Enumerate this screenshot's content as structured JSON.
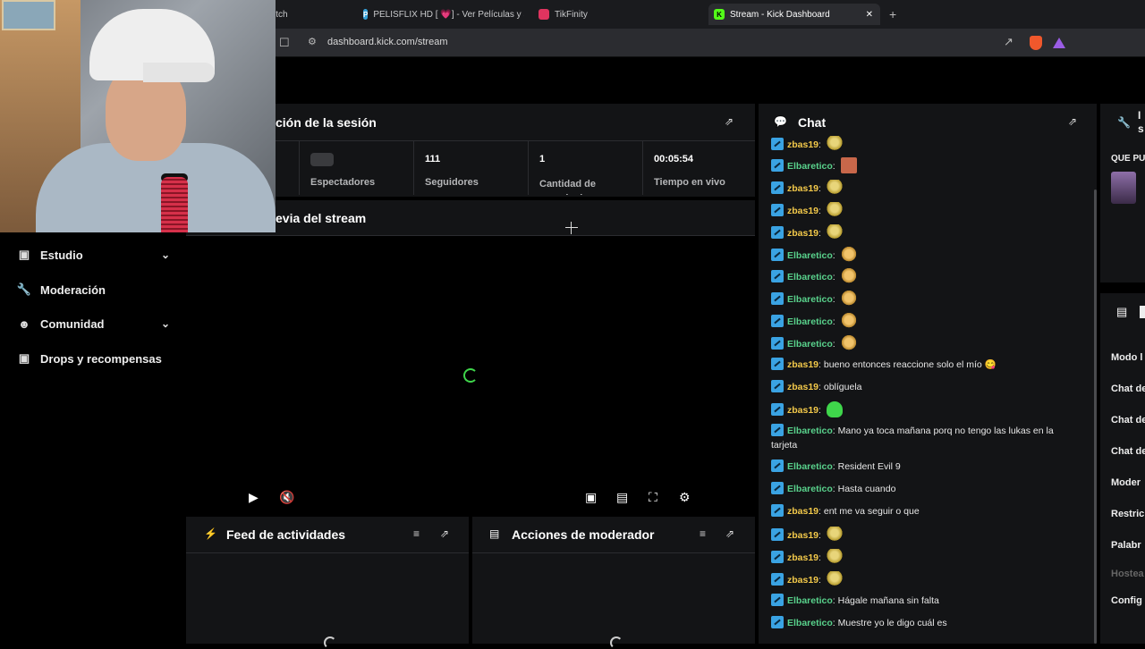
{
  "browser": {
    "tabs": [
      {
        "label": "itch",
        "active": false
      },
      {
        "label": "PELISFLIX HD [ 💗] - Ver Películas y S",
        "active": false
      },
      {
        "label": "TikFinity",
        "active": false
      },
      {
        "label": "Stream - Kick Dashboard",
        "active": true
      }
    ],
    "close_glyph": "✕",
    "new_tab_glyph": "+",
    "url": "dashboard.kick.com/stream"
  },
  "sidebar": {
    "items": [
      {
        "label": "Estudio",
        "icon": "studio-icon",
        "has_chevron": true
      },
      {
        "label": "Moderación",
        "icon": "wrench-icon",
        "has_chevron": false
      },
      {
        "label": "Comunidad",
        "icon": "community-icon",
        "has_chevron": true
      },
      {
        "label": "Drops y recompensas",
        "icon": "gift-icon",
        "has_chevron": false
      }
    ]
  },
  "session": {
    "title": "ción de la sesión",
    "stats": [
      {
        "value": "",
        "label": "Espectadores"
      },
      {
        "value": "111",
        "label": "Seguidores"
      },
      {
        "value": "1",
        "label": "Cantidad de suscripciones"
      },
      {
        "value": "00:05:54",
        "label": "Tiempo en vivo"
      }
    ]
  },
  "preview": {
    "title": "evia del stream"
  },
  "activity_feed": {
    "title": "Feed de actividades"
  },
  "mod_actions": {
    "title": "Acciones de moderador"
  },
  "chat": {
    "title": "Chat",
    "messages": [
      {
        "user": "zbas19",
        "text": "",
        "emote": "em-corn"
      },
      {
        "user": "Elbaretico",
        "text": "",
        "emote": "em-face"
      },
      {
        "user": "zbas19",
        "text": "",
        "emote": "em-corn"
      },
      {
        "user": "zbas19",
        "text": "",
        "emote": "em-corn"
      },
      {
        "user": "zbas19",
        "text": "",
        "emote": "em-corn"
      },
      {
        "user": "Elbaretico",
        "text": "",
        "emote": "em-chicken"
      },
      {
        "user": "Elbaretico",
        "text": "",
        "emote": "em-chicken"
      },
      {
        "user": "Elbaretico",
        "text": "",
        "emote": "em-chicken"
      },
      {
        "user": "Elbaretico",
        "text": "",
        "emote": "em-chicken"
      },
      {
        "user": "Elbaretico",
        "text": "",
        "emote": "em-chicken"
      },
      {
        "user": "zbas19",
        "text": "bueno entonces reaccione solo el mío 😋",
        "emote": ""
      },
      {
        "user": "zbas19",
        "text": "oblíguela",
        "emote": ""
      },
      {
        "user": "zbas19",
        "text": "",
        "emote": "em-ghost"
      },
      {
        "user": "Elbaretico",
        "text": "Mano ya toca mañana porq no tengo las lukas en la tarjeta",
        "emote": ""
      },
      {
        "user": "Elbaretico",
        "text": "Resident Evil 9",
        "emote": ""
      },
      {
        "user": "Elbaretico",
        "text": "Hasta cuando",
        "emote": ""
      },
      {
        "user": "zbas19",
        "text": "ent me va seguir o que",
        "emote": ""
      },
      {
        "user": "zbas19",
        "text": "",
        "emote": "em-corn"
      },
      {
        "user": "zbas19",
        "text": "",
        "emote": "em-corn"
      },
      {
        "user": "zbas19",
        "text": "",
        "emote": "em-corn"
      },
      {
        "user": "Elbaretico",
        "text": "Hágale mañana sin falta",
        "emote": ""
      },
      {
        "user": "Elbaretico",
        "text": "Muestre yo le digo cuál es",
        "emote": ""
      }
    ]
  },
  "right_column": {
    "header_fragment": "I s",
    "pinned_label": "QUE PU",
    "settings_items": [
      "Modo l",
      "Chat de",
      "Chat de",
      "Chat de",
      "Moder",
      "Restric",
      "Palabr",
      "Hostea",
      "Config"
    ]
  }
}
